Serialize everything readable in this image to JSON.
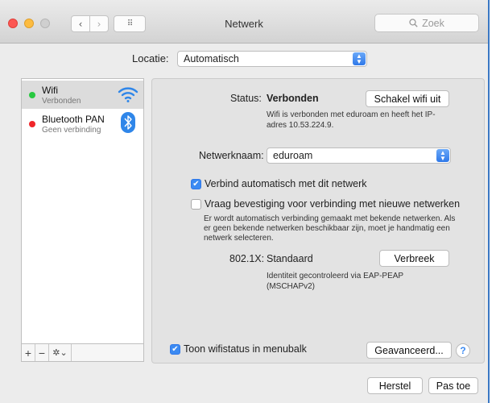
{
  "window": {
    "title": "Netwerk"
  },
  "toolbar": {
    "back": "‹",
    "forward": "›",
    "grid": "⠿",
    "search_placeholder": "Zoek"
  },
  "location": {
    "label": "Locatie:",
    "value": "Automatisch"
  },
  "services": [
    {
      "name": "Wifi",
      "status": "Verbonden",
      "dot_color": "#28c840",
      "icon": "wifi-icon"
    },
    {
      "name": "Bluetooth PAN",
      "status": "Geen verbinding",
      "dot_color": "#f0262a",
      "icon": "bluetooth-icon"
    }
  ],
  "sidebar_toolbar": {
    "add": "+",
    "remove": "−",
    "action": "✲⌄"
  },
  "detail": {
    "status_label": "Status:",
    "status_value": "Verbonden",
    "toggle_button": "Schakel wifi uit",
    "status_desc_1": "Wifi is verbonden met eduroam en heeft het IP-",
    "status_desc_2": "adres 10.53.224.9.",
    "network_label": "Netwerknaam:",
    "network_value": "eduroam",
    "auto_join": {
      "label": "Verbind automatisch met dit netwerk",
      "checked": true
    },
    "ask_join": {
      "label": "Vraag bevestiging voor verbinding met nieuwe netwerken",
      "checked": false
    },
    "ask_desc_1": "Er wordt automatisch verbinding gemaakt met bekende netwerken. Als",
    "ask_desc_2": "er geen bekende netwerken beschikbaar zijn, moet je handmatig een",
    "ask_desc_3": "netwerk selecteren.",
    "dot1x_label": "802.1X:",
    "dot1x_value": "Standaard",
    "disconnect_button": "Verbreek",
    "auth_desc_1": "Identiteit gecontroleerd via EAP-PEAP",
    "auth_desc_2": "(MSCHAPv2)",
    "menubar": {
      "label": "Toon wifistatus in menubalk",
      "checked": true
    },
    "advanced_button": "Geavanceerd...",
    "help": "?"
  },
  "footer": {
    "revert_button": "Herstel",
    "apply_button": "Pas toe"
  },
  "colors": {
    "accent": "#3b8af2",
    "selection": "#dcdcdc",
    "frame": "#3a78c4"
  }
}
